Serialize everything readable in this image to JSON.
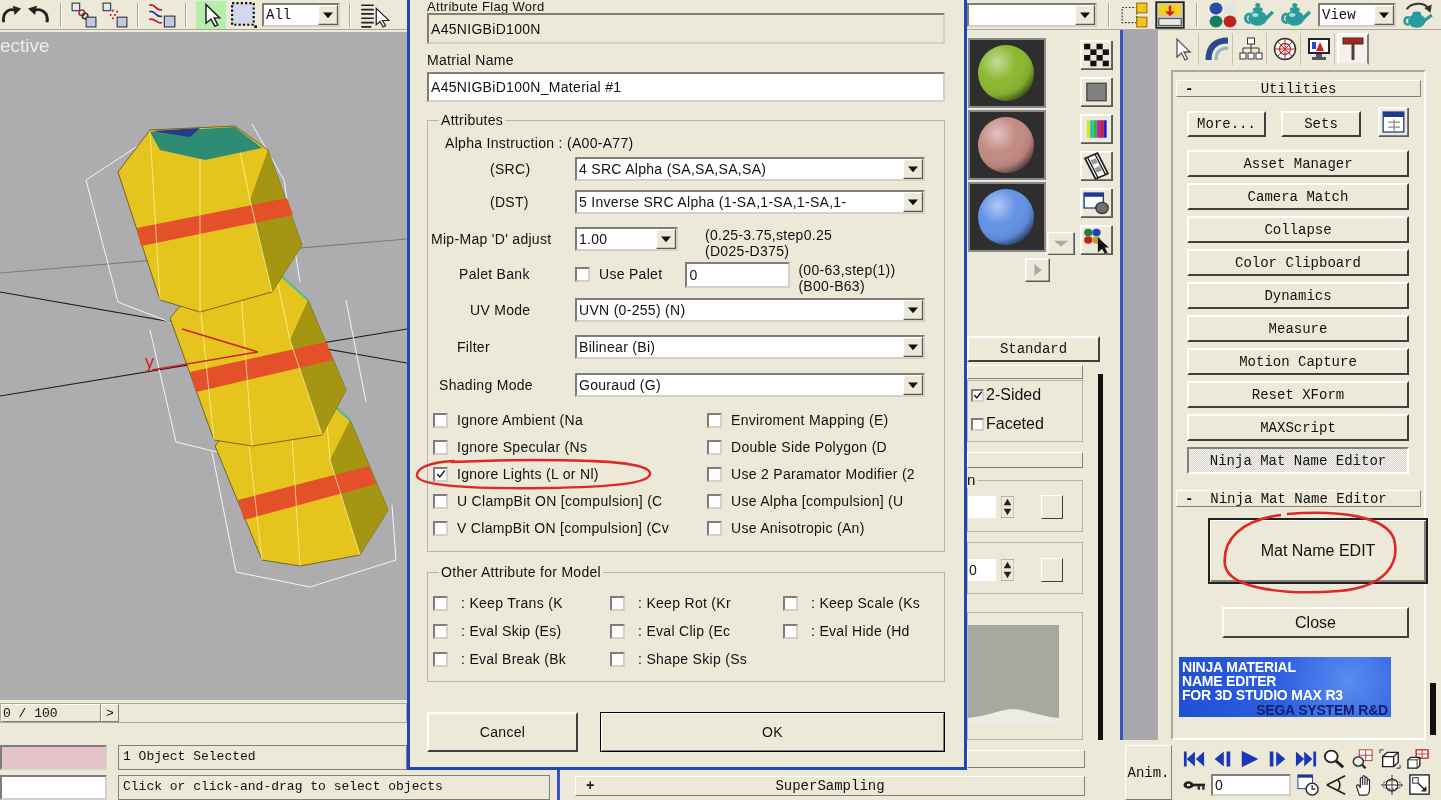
{
  "toolbar": {
    "selection_filter": "All",
    "view_dropdown": "View"
  },
  "viewport": {
    "label": "ective",
    "axis_label": "y"
  },
  "timeline": {
    "frame_counter": "0 / 100",
    "next_button": ">"
  },
  "dialog": {
    "flag_word": {
      "label": "Attribute Flag Word",
      "value": "A45NIGBiD100N"
    },
    "material_name": {
      "label": "Matrial Name",
      "value": "A45NIGBiD100N_Material #1"
    },
    "attributes": {
      "title": "Attributes",
      "alpha_instruction": "Alpha Instruction : (A00-A77)",
      "src": {
        "label": "(SRC)",
        "value": "4 SRC Alpha (SA,SA,SA,SA)"
      },
      "dst": {
        "label": "(DST)",
        "value": "5 Inverse SRC Alpha (1-SA,1-SA,1-SA,1-"
      },
      "mipmap": {
        "label": "Mip-Map 'D' adjust",
        "value": "1.00",
        "range": "(0.25-3.75,step0.25",
        "code": "(D025-D375)"
      },
      "palet_bank": {
        "label": "Palet Bank",
        "checkbox": {
          "label": "Use Palet",
          "checked": false
        },
        "value": "0",
        "range": "(00-63,step(1))",
        "code": "(B00-B63)"
      },
      "uv_mode": {
        "label": "UV Mode",
        "value": "UVN (0-255) (N)"
      },
      "filter": {
        "label": "Filter",
        "value": "Bilinear (Bi)"
      },
      "shading_mode": {
        "label": "Shading Mode",
        "value": "Gouraud (G)"
      },
      "flags": [
        {
          "label": "Ignore Ambient (Na",
          "checked": false,
          "circled": false
        },
        {
          "label": "Enviroment Mapping (E)",
          "checked": false,
          "circled": false
        },
        {
          "label": "Ignore Specular (Ns",
          "checked": false,
          "circled": false
        },
        {
          "label": "Double Side Polygon (D",
          "checked": false,
          "circled": false
        },
        {
          "label": "Ignore Lights (L or Nl)",
          "checked": true,
          "circled": true
        },
        {
          "label": "Use 2 Paramator Modifier (2",
          "checked": false,
          "circled": false
        },
        {
          "label": "U ClampBit ON [compulsion] (C",
          "checked": false,
          "circled": false
        },
        {
          "label": "Use Alpha [compulsion] (U",
          "checked": false,
          "circled": false
        },
        {
          "label": "V ClampBit ON [compulsion] (Cv",
          "checked": false,
          "circled": false
        },
        {
          "label": "Use Anisotropic (An)",
          "checked": false,
          "circled": false
        }
      ]
    },
    "model_attributes": {
      "title": "Other Attribute for Model",
      "flags": [
        {
          "label": ": Keep Trans (K",
          "checked": false
        },
        {
          "label": ": Keep Rot (Kr",
          "checked": false
        },
        {
          "label": ": Keep Scale (Ks",
          "checked": false
        },
        {
          "label": ": Eval Skip (Es)",
          "checked": false
        },
        {
          "label": ": Eval Clip (Ec",
          "checked": false
        },
        {
          "label": ": Eval Hide (Hd",
          "checked": false
        },
        {
          "label": ": Eval Break (Bk",
          "checked": false
        },
        {
          "label": ": Shape Skip (Ss",
          "checked": false
        }
      ]
    },
    "buttons": [
      {
        "label": "Cancel",
        "default": false
      },
      {
        "label": "OK",
        "default": true
      }
    ]
  },
  "material_editor": {
    "slots": [
      {
        "color": "#8cb832"
      },
      {
        "color": "#c48a84"
      },
      {
        "color": "#6492e6"
      }
    ],
    "material_type": "Standard",
    "shader_options": [
      {
        "label": "2-Sided",
        "checked": true
      },
      {
        "label": "Faceted",
        "checked": false
      }
    ],
    "group_label": "n",
    "spinner_value": "0",
    "rollouts": [
      {
        "sign": "+",
        "label": "SuperSampling"
      }
    ]
  },
  "command_panel": {
    "tabs": [
      {
        "kind": "create",
        "selected": false
      },
      {
        "kind": "modify",
        "selected": false
      },
      {
        "kind": "hierarchy",
        "selected": false
      },
      {
        "kind": "motion",
        "selected": false
      },
      {
        "kind": "display",
        "selected": false
      },
      {
        "kind": "utilities",
        "selected": true
      }
    ],
    "utilities": {
      "sign": "-",
      "title": "Utilities",
      "more_button": "More...",
      "sets_button": "Sets",
      "buttons": [
        {
          "label": "Asset Manager",
          "selected": false
        },
        {
          "label": "Camera Match",
          "selected": false
        },
        {
          "label": "Collapse",
          "selected": false
        },
        {
          "label": "Color Clipboard",
          "selected": false
        },
        {
          "label": "Dynamics",
          "selected": false
        },
        {
          "label": "Measure",
          "selected": false
        },
        {
          "label": "Motion Capture",
          "selected": false
        },
        {
          "label": "Reset XForm",
          "selected": false
        },
        {
          "label": "MAXScript",
          "selected": false
        },
        {
          "label": "Ninja Mat Name Editor",
          "selected": true
        }
      ]
    },
    "ninja": {
      "sign": "-",
      "title": "Ninja Mat Name Editor",
      "edit_button": {
        "label": "Mat Name EDIT",
        "circled": true
      },
      "close_button": "Close",
      "banner": [
        "NINJA MATERIAL",
        "NAME EDITER",
        "FOR 3D STUDIO MAX R3",
        "SEGA SYSTEM R&D"
      ]
    }
  },
  "status_bar": {
    "selection": "1 Object Selected",
    "prompt": "Click or click-and-drag to select objects"
  },
  "anim_controls": {
    "anim_button": "Anim.",
    "current_frame": "0"
  }
}
